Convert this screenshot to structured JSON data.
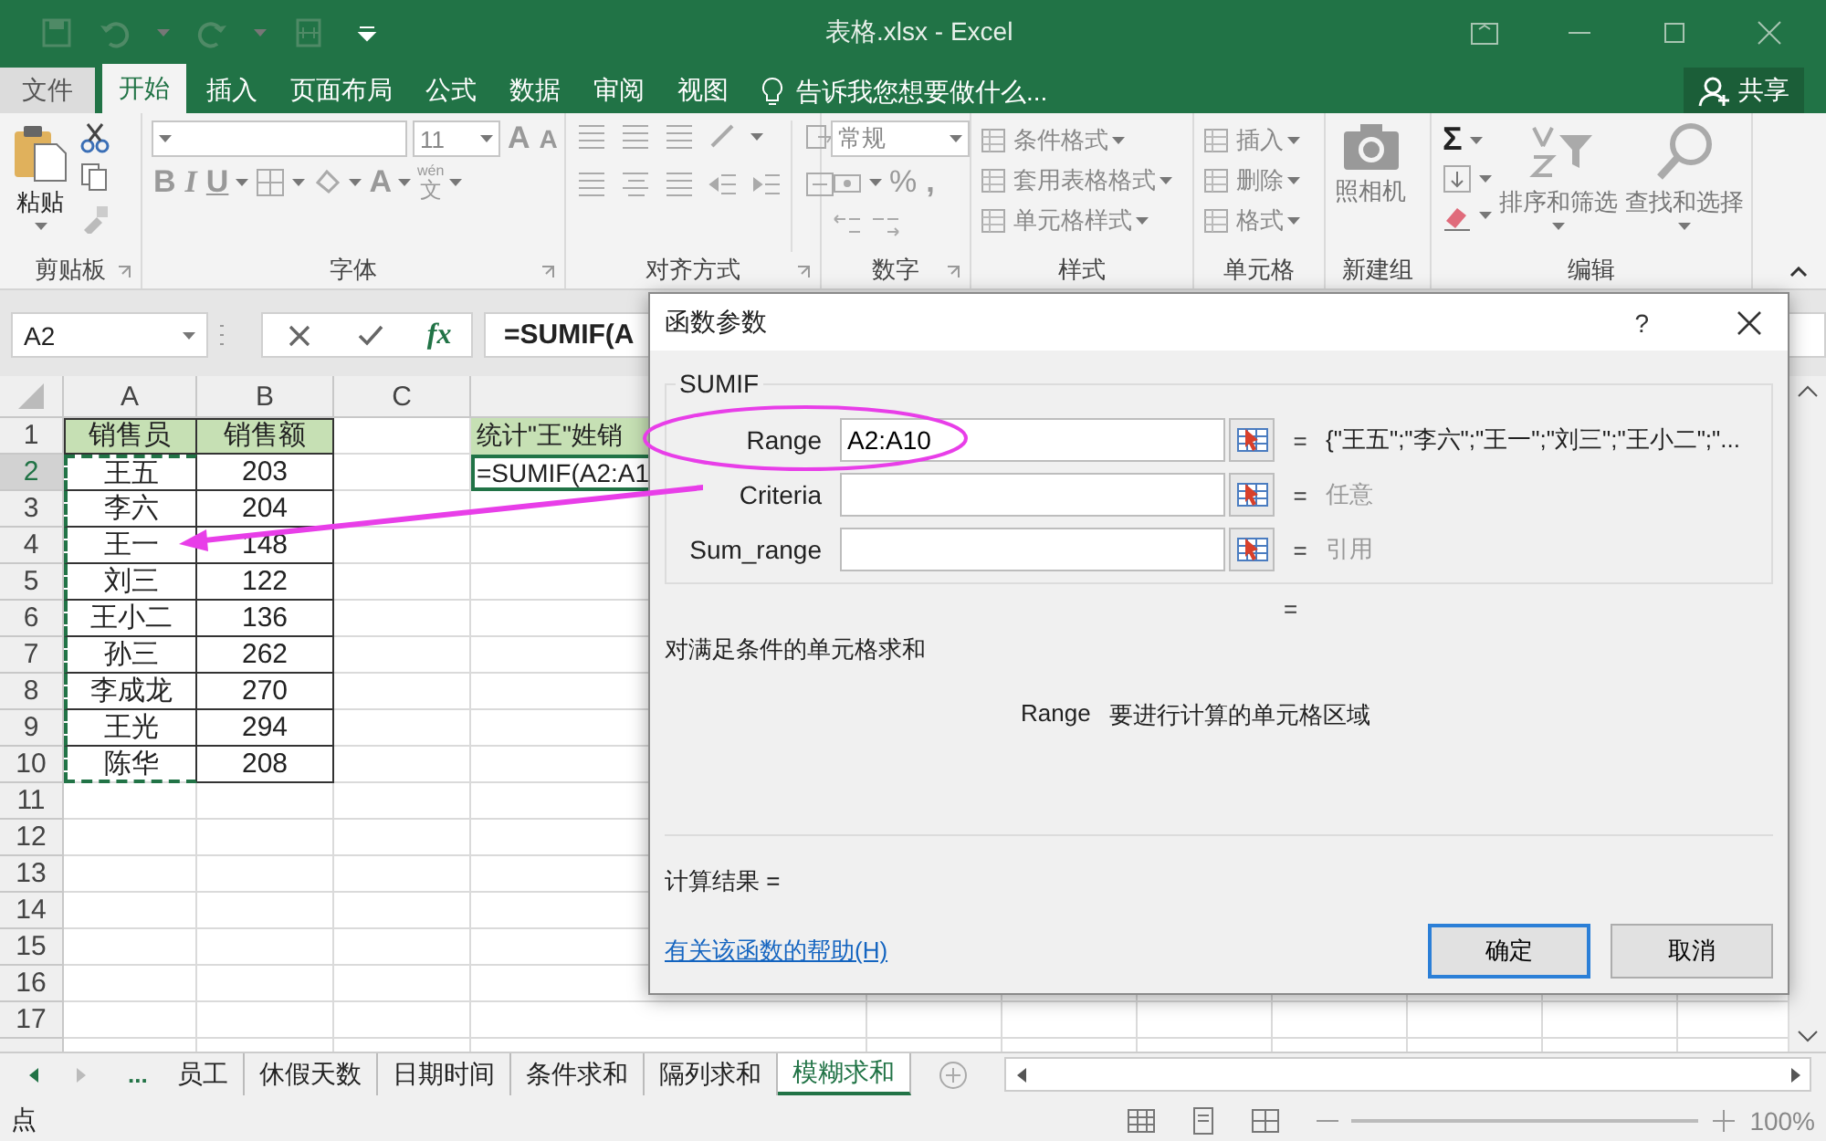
{
  "window": {
    "title": "表格.xlsx - Excel"
  },
  "ribbon_tabs": [
    {
      "label": "文件",
      "selected": false
    },
    {
      "label": "开始",
      "selected": true
    },
    {
      "label": "插入",
      "selected": false
    },
    {
      "label": "页面布局",
      "selected": false
    },
    {
      "label": "公式",
      "selected": false
    },
    {
      "label": "数据",
      "selected": false
    },
    {
      "label": "审阅",
      "selected": false
    },
    {
      "label": "视图",
      "selected": false
    }
  ],
  "tell_me": {
    "placeholder": "告诉我您想要做什么..."
  },
  "share_button": {
    "label": "共享"
  },
  "ribbon_groups": [
    {
      "kind": "clipboard",
      "label": "剪贴板",
      "items": [
        "粘贴"
      ]
    },
    {
      "kind": "font",
      "label": "字体",
      "items": [
        "11",
        "A",
        "A",
        "B",
        "I",
        "U",
        "A",
        "wén",
        "文"
      ]
    },
    {
      "kind": "alignment",
      "label": "对齐方式"
    },
    {
      "kind": "number",
      "label": "数字",
      "items": [
        "常规",
        "%",
        ","
      ]
    },
    {
      "kind": "styles",
      "label": "样式",
      "items": [
        "条件格式",
        "套用表格格式",
        "单元格样式"
      ]
    },
    {
      "kind": "cells",
      "label": "单元格",
      "items": [
        "插入",
        "删除",
        "格式"
      ]
    },
    {
      "kind": "new_group",
      "label": "新建组",
      "items": [
        "照相机"
      ]
    },
    {
      "kind": "editing",
      "label": "编辑",
      "items": [
        "Σ",
        "排序和筛选",
        "查找和选择"
      ]
    }
  ],
  "formula_bar": {
    "name_box": "A2",
    "function_button": "fx",
    "formula": "=SUMIF(A"
  },
  "columns": [
    {
      "label": "A"
    },
    {
      "label": "B"
    },
    {
      "label": "C"
    }
  ],
  "rows": [
    {
      "number": "1",
      "selected": false,
      "cells": [
        {
          "text": "销售员",
          "kind": "header",
          "referenced": false
        },
        {
          "text": "销售额",
          "kind": "header"
        }
      ]
    },
    {
      "number": "2",
      "selected": true,
      "cells": [
        {
          "text": "王五",
          "referenced": true
        },
        {
          "text": "203"
        }
      ]
    },
    {
      "number": "3",
      "selected": false,
      "cells": [
        {
          "text": "李六",
          "referenced": true
        },
        {
          "text": "204"
        }
      ]
    },
    {
      "number": "4",
      "selected": false,
      "cells": [
        {
          "text": "王一",
          "referenced": true
        },
        {
          "text": "148"
        }
      ]
    },
    {
      "number": "5",
      "selected": false,
      "cells": [
        {
          "text": "刘三",
          "referenced": true
        },
        {
          "text": "122"
        }
      ]
    },
    {
      "number": "6",
      "selected": false,
      "cells": [
        {
          "text": "王小二",
          "referenced": true
        },
        {
          "text": "136"
        }
      ]
    },
    {
      "number": "7",
      "selected": false,
      "cells": [
        {
          "text": "孙三",
          "referenced": true
        },
        {
          "text": "262"
        }
      ]
    },
    {
      "number": "8",
      "selected": false,
      "cells": [
        {
          "text": "李成龙",
          "referenced": true
        },
        {
          "text": "270"
        }
      ]
    },
    {
      "number": "9",
      "selected": false,
      "cells": [
        {
          "text": "王光",
          "referenced": true
        },
        {
          "text": "294"
        }
      ]
    },
    {
      "number": "10",
      "selected": false,
      "cells": [
        {
          "text": "陈华",
          "referenced": true
        },
        {
          "text": "208"
        }
      ]
    },
    {
      "number": "11",
      "selected": false
    },
    {
      "number": "12",
      "selected": false
    },
    {
      "number": "13",
      "selected": false
    },
    {
      "number": "14",
      "selected": false
    },
    {
      "number": "15",
      "selected": false
    },
    {
      "number": "16",
      "selected": false
    },
    {
      "number": "17",
      "selected": false
    }
  ],
  "column_4_cells": [
    {
      "text": "统计\"王\"姓销",
      "kind": "header",
      "active": false
    },
    {
      "text": "=SUMIF(A2:A1",
      "active": true
    }
  ],
  "dialog": {
    "title": "函数参数",
    "help": "?",
    "function_name": "SUMIF",
    "arguments": [
      {
        "label": "Range",
        "value": "A2:A10",
        "equals": "=",
        "result": "{\"王五\";\"李六\";\"王一\";\"刘三\";\"王小二\";\"...",
        "muted": false
      },
      {
        "label": "Criteria",
        "equals": "=",
        "result": "任意",
        "muted": true
      },
      {
        "label": "Sum_range",
        "equals": "=",
        "result": "引用",
        "muted": true
      }
    ],
    "formula_equals": "=",
    "description": "对满足条件的单元格求和",
    "argument_help": {
      "name": "Range",
      "text": "要进行计算的单元格区域"
    },
    "result_label": "计算结果 =",
    "help_link": "有关该函数的帮助(H)",
    "buttons": [
      {
        "label": "确定",
        "default": true
      },
      {
        "label": "取消",
        "default": false
      }
    ]
  },
  "sheet_tabs": {
    "more": "...",
    "tabs": [
      {
        "label": "员工",
        "selected": false
      },
      {
        "label": "休假天数",
        "selected": false
      },
      {
        "label": "日期时间",
        "selected": false
      },
      {
        "label": "条件求和",
        "selected": false
      },
      {
        "label": "隔列求和",
        "selected": false
      },
      {
        "label": "模糊求和",
        "selected": true
      }
    ]
  },
  "status_bar": {
    "mode": "点",
    "zoom": "100%"
  }
}
